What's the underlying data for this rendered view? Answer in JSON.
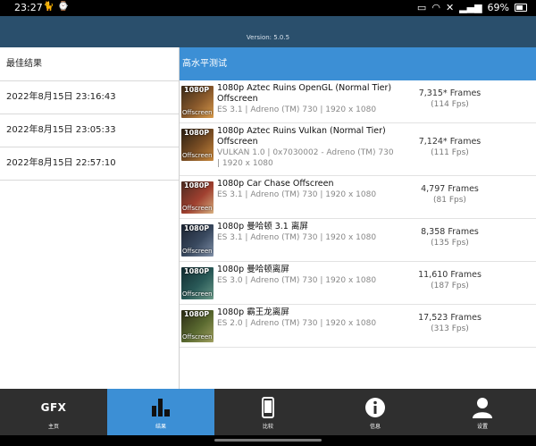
{
  "status_bar": {
    "time": "23:27",
    "battery": "69%"
  },
  "header": {
    "version": "Version: 5.0.5"
  },
  "left_panel": {
    "title": "最佳结果",
    "items": [
      {
        "label": "2022年8月15日 23:16:43"
      },
      {
        "label": "2022年8月15日 23:05:33"
      },
      {
        "label": "2022年8月15日 22:57:10"
      }
    ]
  },
  "right_panel": {
    "title": "高水平测试",
    "tests": [
      {
        "res": "1080P",
        "tag": "Offscreen",
        "name": "1080p Aztec Ruins OpenGL (Normal Tier) Offscreen",
        "details": "ES 3.1 | Adreno (TM) 730 | 1920 x 1080",
        "frames": "7,315* Frames",
        "fps": "(114 Fps)",
        "thumb_colors": [
          "#3a2a18",
          "#8a5a2c",
          "#d89a4a"
        ]
      },
      {
        "res": "1080P",
        "tag": "Offscreen",
        "name": "1080p Aztec Ruins Vulkan (Normal Tier) Offscreen",
        "details": "VULKAN 1.0 | 0x7030002 - Adreno (TM) 730 | 1920 x 1080",
        "frames": "7,124* Frames",
        "fps": "(111 Fps)",
        "thumb_colors": [
          "#2a1e12",
          "#7a4e24",
          "#c8883c"
        ]
      },
      {
        "res": "1080P",
        "tag": "Offscreen",
        "name": "1080p Car Chase Offscreen",
        "details": "ES 3.1 | Adreno (TM) 730 | 1920 x 1080",
        "frames": "4,797 Frames",
        "fps": "(81 Fps)",
        "thumb_colors": [
          "#4a2a20",
          "#a04030",
          "#d8b080"
        ]
      },
      {
        "res": "1080P",
        "tag": "Offscreen",
        "name": "1080p 曼哈顿 3.1 离屏",
        "details": "ES 3.1 | Adreno (TM) 730 | 1920 x 1080",
        "frames": "8,358 Frames",
        "fps": "(135 Fps)",
        "thumb_colors": [
          "#1a2230",
          "#3a4a60",
          "#8090a8"
        ]
      },
      {
        "res": "1080P",
        "tag": "Offscreen",
        "name": "1080p 曼哈顿离屏",
        "details": "ES 3.0 | Adreno (TM) 730 | 1920 x 1080",
        "frames": "11,610 Frames",
        "fps": "(187 Fps)",
        "thumb_colors": [
          "#102a30",
          "#2a5a58",
          "#6a9a88"
        ]
      },
      {
        "res": "1080P",
        "tag": "Offscreen",
        "name": "1080p 霸王龙离屏",
        "details": "ES 2.0 | Adreno (TM) 730 | 1920 x 1080",
        "frames": "17,523 Frames",
        "fps": "(313 Fps)",
        "thumb_colors": [
          "#2a2a14",
          "#5a6a30",
          "#a0a060"
        ]
      }
    ]
  },
  "nav": {
    "items": [
      {
        "label": "主页",
        "icon": "gfx-logo"
      },
      {
        "label": "结果",
        "icon": "bar-chart-icon",
        "active": true
      },
      {
        "label": "比较",
        "icon": "phone-icon"
      },
      {
        "label": "信息",
        "icon": "info-icon"
      },
      {
        "label": "设置",
        "icon": "person-icon"
      }
    ],
    "gfx_text": "GFX"
  },
  "colors": {
    "header": "#2a4f6c",
    "accent": "#3c8fd5",
    "nav_bg": "#2f2f2f"
  }
}
